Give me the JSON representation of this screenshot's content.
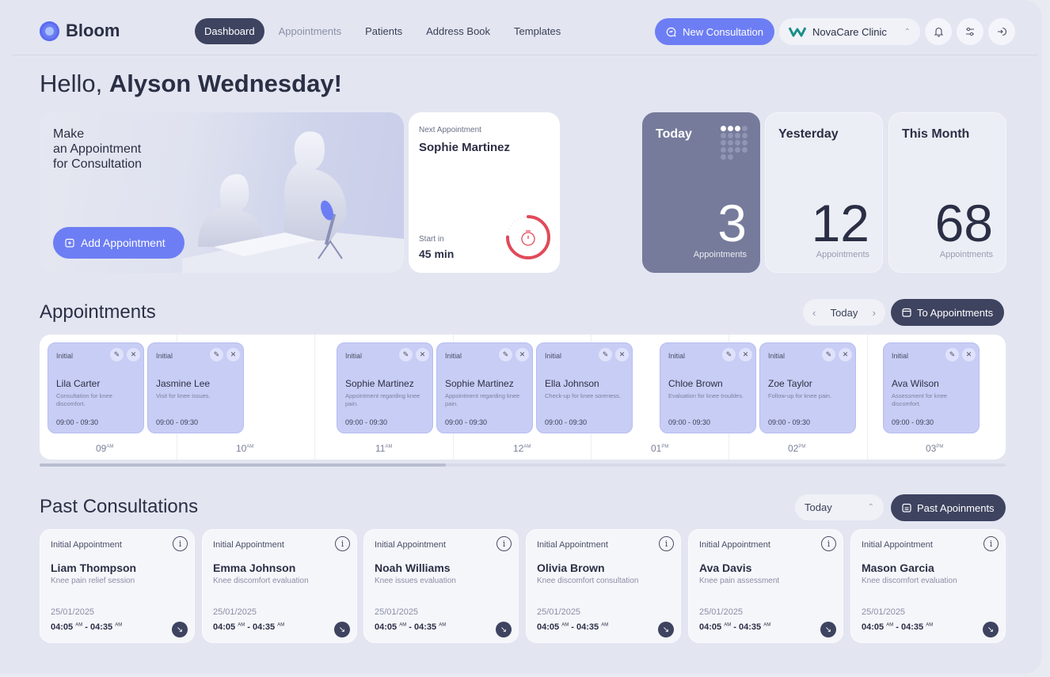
{
  "app": {
    "name": "Bloom"
  },
  "nav": {
    "links": [
      {
        "label": "Dashboard"
      },
      {
        "label": "Appointments"
      },
      {
        "label": "Patients"
      },
      {
        "label": "Address Book"
      },
      {
        "label": "Templates"
      }
    ],
    "new_consultation": "New Consultation",
    "clinic": "NovaCare Clinic"
  },
  "greeting": {
    "hello": "Hello,",
    "name": "Alyson Wednesday!"
  },
  "hero": {
    "line1": "Make",
    "line2": "an Appointment",
    "line3": "for Consultation",
    "button": "Add Appointment"
  },
  "next_appointment": {
    "label": "Next Appointment",
    "name": "Sophie Martinez",
    "start_label": "Start in",
    "start_value": "45 min",
    "progress": 0.75
  },
  "stats": [
    {
      "title": "Today",
      "value": "3",
      "caption": "Appointments"
    },
    {
      "title": "Yesterday",
      "value": "12",
      "caption": "Appointments"
    },
    {
      "title": "This Month",
      "value": "68",
      "caption": "Appointments"
    }
  ],
  "appointments_section": {
    "title": "Appointments",
    "day": "Today",
    "button": "To Appointments",
    "hours": [
      {
        "h": "09",
        "p": "AM"
      },
      {
        "h": "10",
        "p": "AM"
      },
      {
        "h": "11",
        "p": "AM"
      },
      {
        "h": "12",
        "p": "AM"
      },
      {
        "h": "01",
        "p": "PM"
      },
      {
        "h": "02",
        "p": "PM"
      },
      {
        "h": "03",
        "p": "PM"
      }
    ],
    "items": [
      {
        "tag": "Initial",
        "name": "Lila Carter",
        "desc": "Consultation for knee discomfort.",
        "time": "09:00 - 09:30"
      },
      {
        "tag": "Initial",
        "name": "Jasmine Lee",
        "desc": "Visit for knee issues.",
        "time": "09:00 - 09:30"
      },
      {
        "tag": "Initial",
        "name": "Sophie Martinez",
        "desc": "Appointment regarding knee pain.",
        "time": "09:00 - 09:30"
      },
      {
        "tag": "Initial",
        "name": "Sophie Martinez",
        "desc": "Appointment regarding knee pain.",
        "time": "09:00 - 09:30"
      },
      {
        "tag": "Initial",
        "name": "Ella Johnson",
        "desc": "Check-up for knee soreness.",
        "time": "09:00 - 09:30"
      },
      {
        "tag": "Initial",
        "name": "Chloe Brown",
        "desc": "Evaluation for knee troubles.",
        "time": "09:00 - 09:30"
      },
      {
        "tag": "Initial",
        "name": "Zoe Taylor",
        "desc": "Follow-up for knee pain.",
        "time": "09:00 - 09:30"
      },
      {
        "tag": "Initial",
        "name": "Ava Wilson",
        "desc": "Assessment for knee discomfort.",
        "time": "09:00 - 09:30"
      }
    ]
  },
  "past_section": {
    "title": "Past Consultations",
    "filter": "Today",
    "button": "Past Apoinments",
    "cards": [
      {
        "tag": "Initial Appointment",
        "name": "Liam Thompson",
        "desc": "Knee pain relief session",
        "date": "25/01/2025",
        "start": "04:05",
        "start_p": "AM",
        "end": "04:35",
        "end_p": "AM"
      },
      {
        "tag": "Initial Appointment",
        "name": "Emma Johnson",
        "desc": "Knee discomfort evaluation",
        "date": "25/01/2025",
        "start": "04:05",
        "start_p": "AM",
        "end": "04:35",
        "end_p": "AM"
      },
      {
        "tag": "Initial Appointment",
        "name": "Noah Williams",
        "desc": "Knee issues evaluation",
        "date": "25/01/2025",
        "start": "04:05",
        "start_p": "AM",
        "end": "04:35",
        "end_p": "AM"
      },
      {
        "tag": "Initial Appointment",
        "name": "Olivia Brown",
        "desc": "Knee discomfort consultation",
        "date": "25/01/2025",
        "start": "04:05",
        "start_p": "AM",
        "end": "04:35",
        "end_p": "AM"
      },
      {
        "tag": "Initial Appointment",
        "name": "Ava Davis",
        "desc": "Knee pain assessment",
        "date": "25/01/2025",
        "start": "04:05",
        "start_p": "AM",
        "end": "04:35",
        "end_p": "AM"
      },
      {
        "tag": "Initial Appointment",
        "name": "Mason Garcia",
        "desc": "Knee discomfort evaluation",
        "date": "25/01/2025",
        "start": "04:05",
        "start_p": "AM",
        "end": "04:35",
        "end_p": "AM"
      }
    ]
  },
  "icons": {
    "nav": [
      "bell-icon",
      "sliders-icon",
      "logout-icon"
    ],
    "card": [
      "edit-icon",
      "close-icon",
      "info-icon",
      "arrow-down-right-icon"
    ]
  },
  "colors": {
    "accent": "#6d7ef4",
    "dark": "#3e4360",
    "today_card": "#767b9c",
    "appointment_card": "#c8cdf5",
    "timer_ring": "#e04a5a"
  }
}
